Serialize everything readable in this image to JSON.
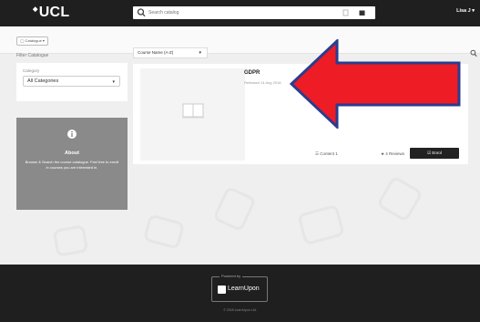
{
  "header": {
    "logo": "UCL",
    "logo_mark": "◆",
    "search_placeholder": "Search catalog",
    "user": "Lisa J ▾"
  },
  "subbar": {
    "catalogue_button": "◯ Catalogue ▾"
  },
  "filter": {
    "title": "Filter Catalogue",
    "category_label": "Category",
    "category_value": "All Categories"
  },
  "about": {
    "title": "About",
    "text": "Browse & Search the course catalogue. Feel free to enroll in courses you are interested in."
  },
  "sort": {
    "value": "Course Name (A-Z)"
  },
  "course": {
    "title": "GDPR",
    "date": "Released 14 Aug 2018",
    "content_label": "☰ Content 1",
    "reviews_label": "★ 4 Reviews",
    "enroll_label": "☑ Enrol"
  },
  "footer": {
    "powered_by": "Powered by",
    "brand": "LearnUpon",
    "copyright": "© 2018 LearnUpon Ltd."
  },
  "colors": {
    "navbar": "#1f1f1f",
    "arrow": "#ee1c24",
    "arrow_outline": "#2a3d8f"
  }
}
